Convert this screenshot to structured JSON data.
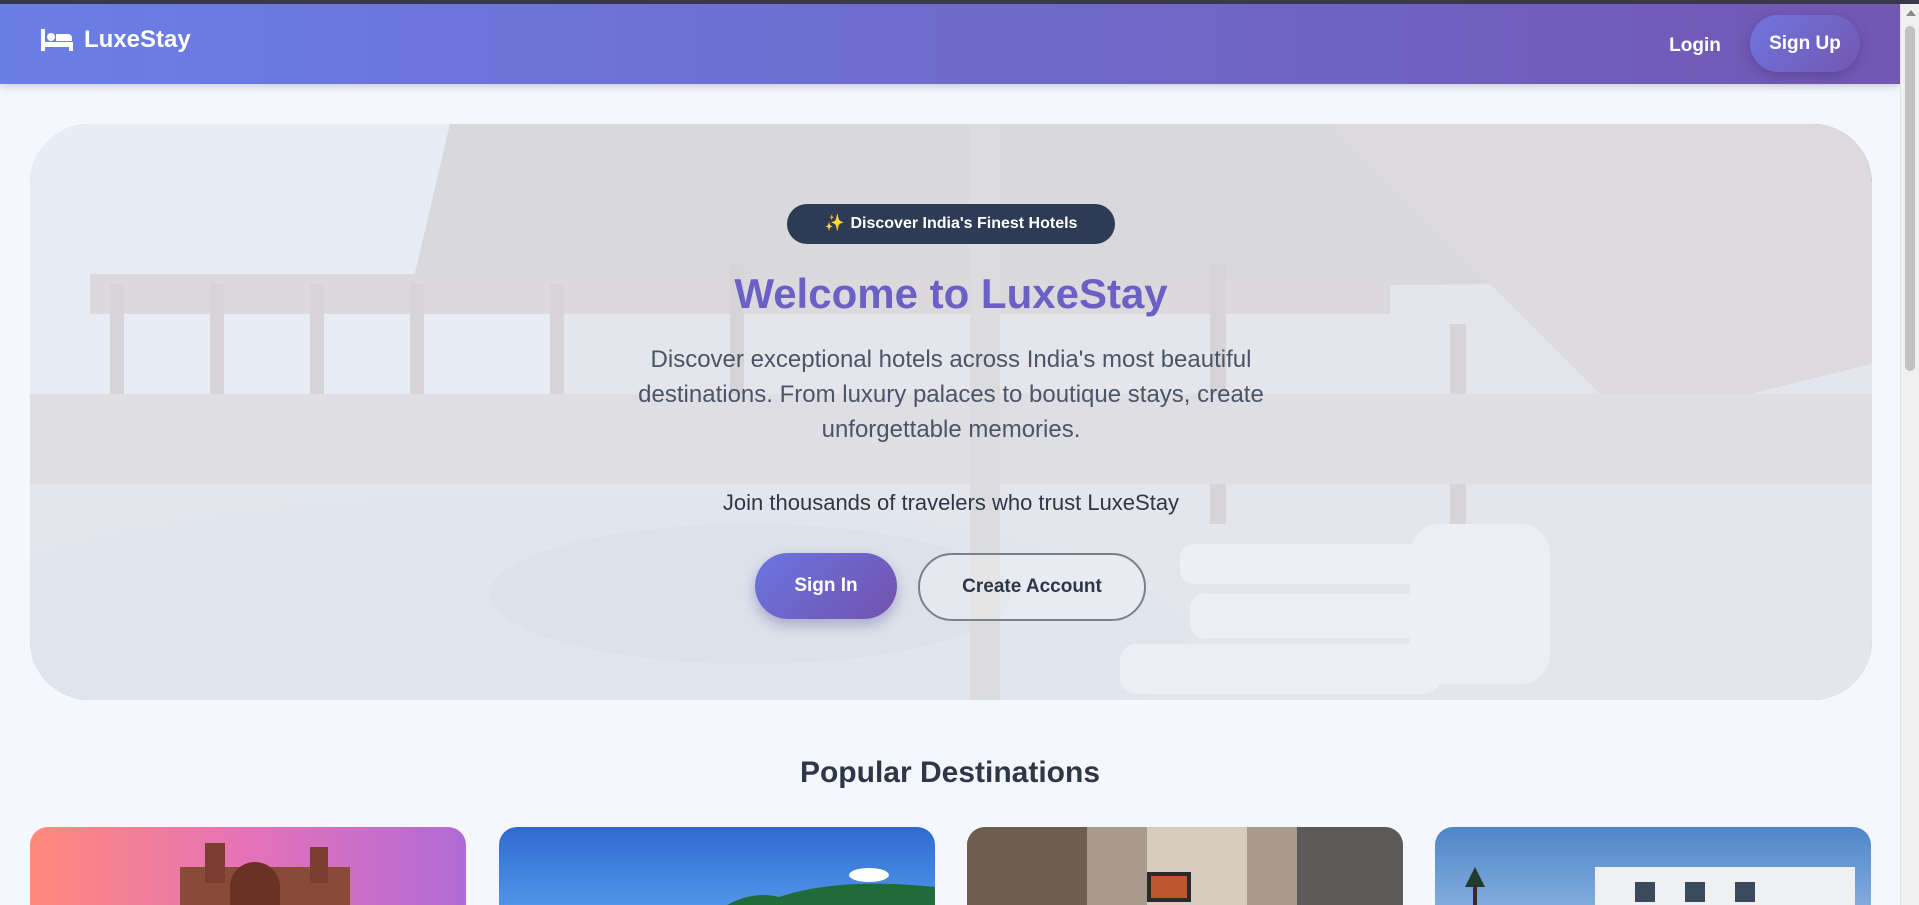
{
  "navbar": {
    "brand_icon": "bed-icon",
    "brand_name": "LuxeStay",
    "login_label": "Login",
    "signup_label": "Sign Up"
  },
  "hero": {
    "badge_icon": "sparkles-icon",
    "badge_text": "Discover India's Finest Hotels",
    "title": "Welcome to LuxeStay",
    "description": "Discover exceptional hotels across India's most beautiful destinations. From luxury palaces to boutique stays, create unforgettable memories.",
    "subtext": "Join thousands of travelers who trust LuxeStay",
    "signin_label": "Sign In",
    "create_account_label": "Create Account"
  },
  "destinations": {
    "title": "Popular Destinations"
  },
  "colors": {
    "brand_gradient_start": "#6a7fe6",
    "brand_gradient_end": "#7257b3",
    "title_color": "#6c5fc6",
    "badge_bg": "#2d3b55",
    "page_bg": "#f4f7fb"
  }
}
